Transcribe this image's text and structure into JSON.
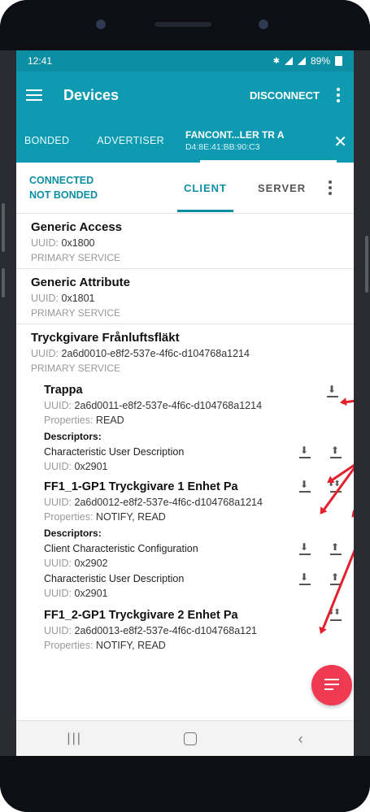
{
  "status_bar": {
    "time": "12:41",
    "battery": "89%"
  },
  "app_bar": {
    "title": "Devices",
    "disconnect_label": "DISCONNECT"
  },
  "tabs": {
    "bonded": "BONDED",
    "advertiser": "ADVERTISER",
    "device_name": "FANCONT...LER TR A",
    "device_address": "D4:8E:41:BB:90:C3"
  },
  "connection": {
    "state": "CONNECTED",
    "bond": "NOT BONDED",
    "client_tab": "CLIENT",
    "server_tab": "SERVER"
  },
  "services": [
    {
      "name": "Generic Access",
      "uuid_label": "UUID: ",
      "uuid": "0x1800",
      "type": "PRIMARY SERVICE"
    },
    {
      "name": "Generic Attribute",
      "uuid_label": "UUID: ",
      "uuid": "0x1801",
      "type": "PRIMARY SERVICE"
    },
    {
      "name": "Tryckgivare Frånluftsfläkt",
      "uuid_label": "UUID: ",
      "uuid": "2a6d0010-e8f2-537e-4f6c-d104768a1214",
      "type": "PRIMARY SERVICE"
    }
  ],
  "characteristics": [
    {
      "name": "Trappa",
      "uuid": "2a6d0011-e8f2-537e-4f6c-d104768a1214",
      "properties_label": "Properties: ",
      "properties": "READ",
      "descriptors_label": "Descriptors:",
      "descriptors": [
        {
          "name": "Characteristic User Description",
          "uuid": "0x2901"
        }
      ]
    },
    {
      "name": "FF1_1-GP1 Tryckgivare 1 Enhet Pa",
      "uuid": "2a6d0012-e8f2-537e-4f6c-d104768a1214",
      "properties_label": "Properties: ",
      "properties": "NOTIFY, READ",
      "descriptors_label": "Descriptors:",
      "descriptors": [
        {
          "name": "Client Characteristic Configuration",
          "uuid": "0x2902"
        },
        {
          "name": "Characteristic User Description",
          "uuid": "0x2901"
        }
      ]
    },
    {
      "name": "FF1_2-GP1 Tryckgivare 2 Enhet Pa",
      "uuid": "2a6d0013-e8f2-537e-4f6c-d104768a121",
      "properties_label": "Properties: ",
      "properties": "NOTIFY, READ"
    }
  ],
  "colors": {
    "accent": "#0e9ab0",
    "accent_text": "#0e8ea3",
    "fab": "#f03a51",
    "annotation_arrow": "#e3202d"
  }
}
